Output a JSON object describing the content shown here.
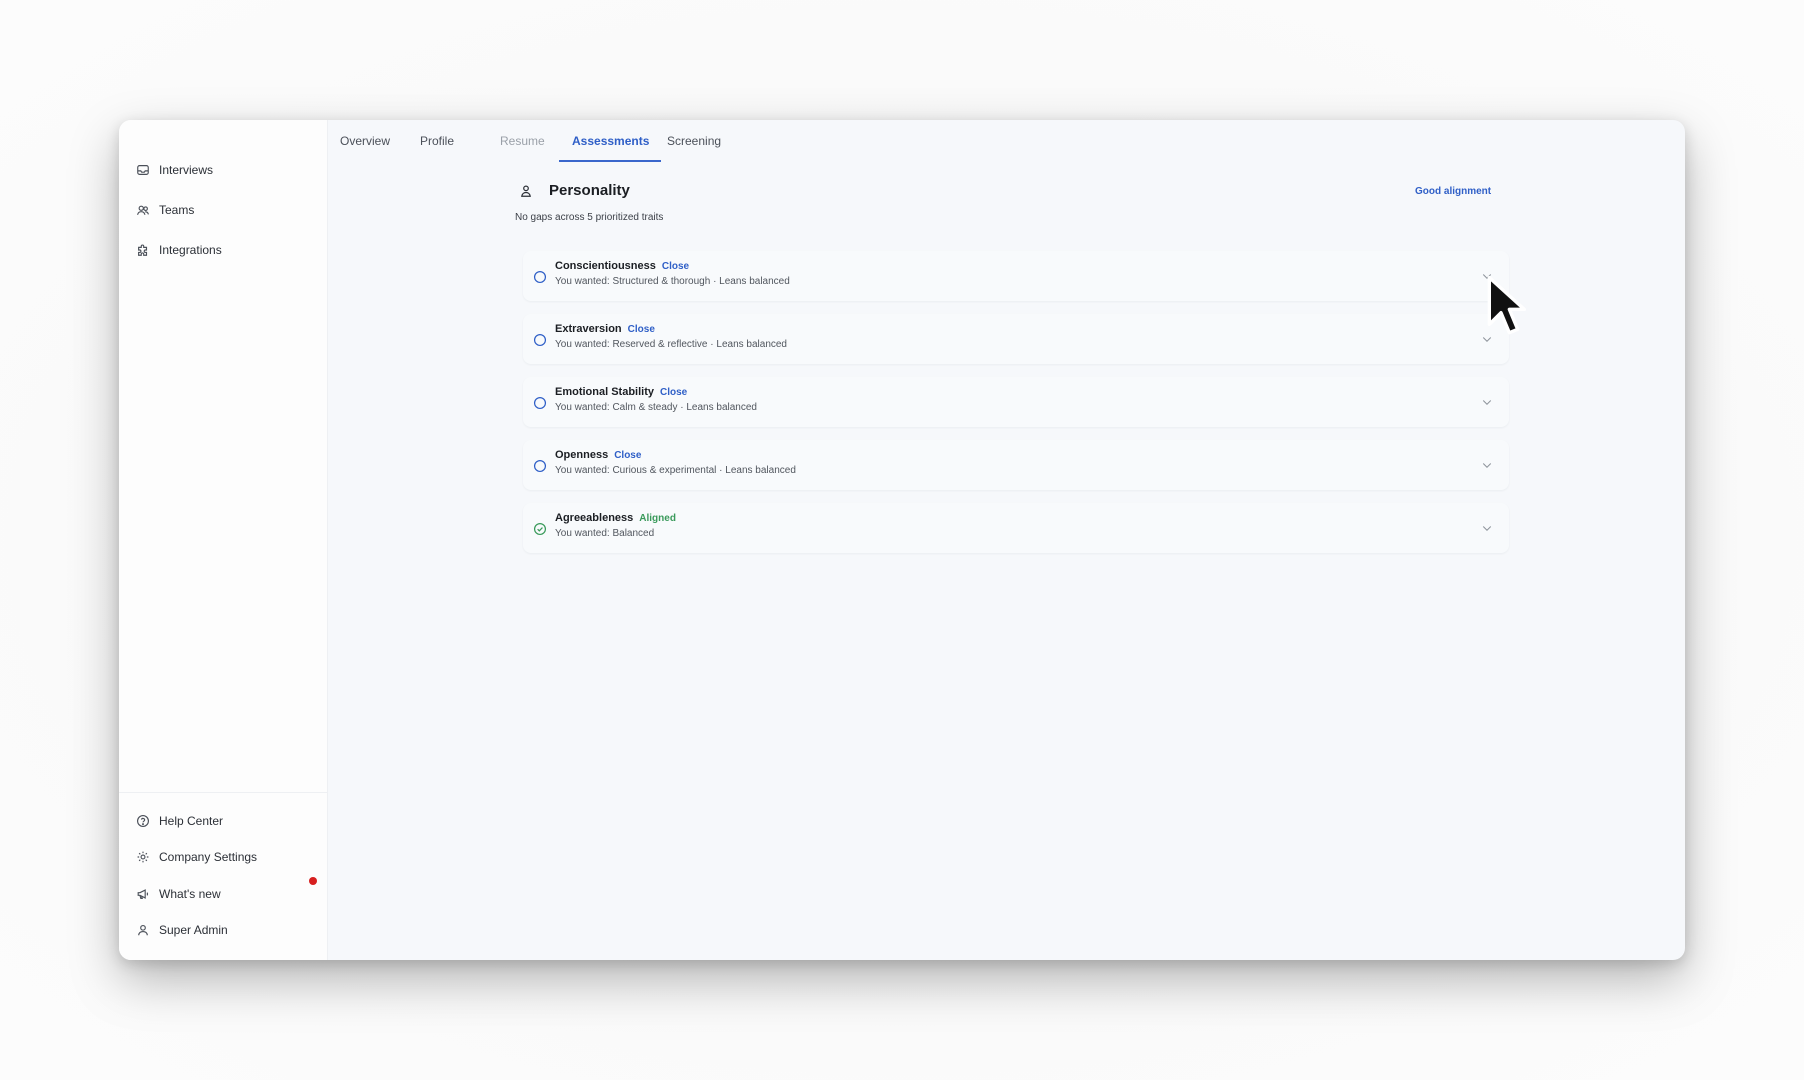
{
  "sidebar": {
    "top_items": [
      {
        "label": "Interviews",
        "icon": "inbox-icon"
      },
      {
        "label": "Teams",
        "icon": "users-icon"
      },
      {
        "label": "Integrations",
        "icon": "puzzle-icon"
      }
    ],
    "bottom_items": [
      {
        "label": "Help Center",
        "icon": "help-circle-icon"
      },
      {
        "label": "Company Settings",
        "icon": "gear-icon"
      },
      {
        "label": "What's new",
        "icon": "megaphone-icon",
        "has_notification": true
      },
      {
        "label": "Super Admin",
        "icon": "user-icon"
      }
    ]
  },
  "tabs": [
    {
      "label": "Overview",
      "state": "normal"
    },
    {
      "label": "Profile",
      "state": "normal"
    },
    {
      "label": "Resume",
      "state": "disabled"
    },
    {
      "label": "Assessments",
      "state": "active"
    },
    {
      "label": "Screening",
      "state": "normal"
    }
  ],
  "personality": {
    "title": "Personality",
    "subtitle": "No gaps across 5 prioritized traits",
    "badge": "Good alignment",
    "traits": [
      {
        "name": "Conscientiousness",
        "match": "Close",
        "detail": "You wanted: Structured & thorough · Leans balanced"
      },
      {
        "name": "Extraversion",
        "match": "Close",
        "detail": "You wanted: Reserved & reflective · Leans balanced"
      },
      {
        "name": "Emotional Stability",
        "match": "Close",
        "detail": "You wanted: Calm & steady · Leans balanced"
      },
      {
        "name": "Openness",
        "match": "Close",
        "detail": "You wanted: Curious & experimental · Leans balanced"
      },
      {
        "name": "Agreeableness",
        "match": "Aligned",
        "detail": "You wanted: Balanced"
      }
    ]
  },
  "colors": {
    "accent": "#2f5fc7",
    "close": "#2f5fc7",
    "aligned": "#3a9a5b",
    "notification": "#d71f1f"
  }
}
